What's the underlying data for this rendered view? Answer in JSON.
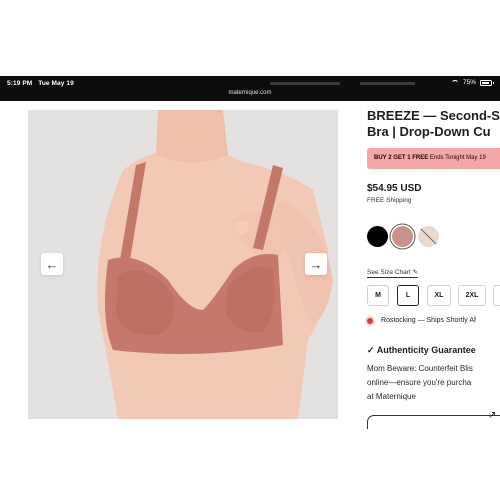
{
  "status_bar": {
    "time": "5:19 PM",
    "date": "Tue May 19",
    "battery": "75%",
    "url": "maternique.com"
  },
  "gallery": {
    "prev_label": "←",
    "next_label": "→"
  },
  "product": {
    "title_line1": "BREEZE — Second-S",
    "title_line2": "Bra | Drop-Down Cu",
    "promo_bold": "BUY 2 GET 1 FREE",
    "promo_text": " Ends Tonight May 19",
    "price": "$54.95 USD",
    "shipping": "FREE Shipping",
    "colors": [
      "black",
      "rose",
      "beige"
    ],
    "size_chart_label": "See Size Chart ✎",
    "sizes": [
      "M",
      "L",
      "XL",
      "2XL"
    ],
    "selected_size": "L",
    "restock_text": "Rostocking — Ships Shortly Af",
    "auth_title": "✓ Authenticity Guarantee",
    "auth_line1": "Mom Beware: Counterfeit Blis",
    "auth_line2": "online—ensure you're purcha",
    "auth_line3": "at Maternique"
  }
}
